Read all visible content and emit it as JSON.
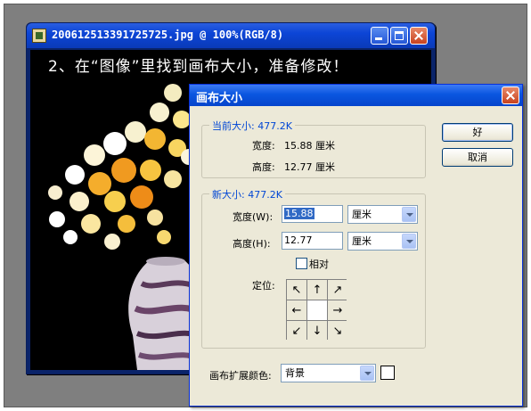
{
  "document_window": {
    "title": "200612513391725725.jpg @ 100%(RGB/8)",
    "caption": "2、在“图像”里找到画布大小，准备修改！",
    "icons": [
      "photoshop-doc-icon",
      "minimize-icon",
      "maximize-icon",
      "close-icon"
    ]
  },
  "dialog": {
    "title": "画布大小",
    "current_size": {
      "legend": "当前大小: 477.2K",
      "width_label": "宽度:",
      "width_value": "15.88 厘米",
      "height_label": "高度:",
      "height_value": "12.77 厘米"
    },
    "new_size": {
      "legend": "新大小: 477.2K",
      "width_label": "宽度(W):",
      "width_value": "15.88",
      "width_unit": "厘米",
      "height_label": "高度(H):",
      "height_value": "12.77",
      "height_unit": "厘米",
      "relative_label": "相对",
      "relative_checked": false,
      "anchor_label": "定位:",
      "anchor_arrows": [
        "↖",
        "↑",
        "↗",
        "←",
        "",
        "→",
        "↙",
        "↓",
        "↘"
      ]
    },
    "extension_color_label": "画布扩展颜色:",
    "extension_color_value": "背景",
    "extension_swatch_color": "#ffffff",
    "ok_label": "好",
    "cancel_label": "取消"
  },
  "colors": {
    "title_bar_blue": "#0a56e0",
    "dialog_face": "#ece9d8",
    "legend_blue": "#0046d5",
    "selection_blue": "#316ac5"
  }
}
